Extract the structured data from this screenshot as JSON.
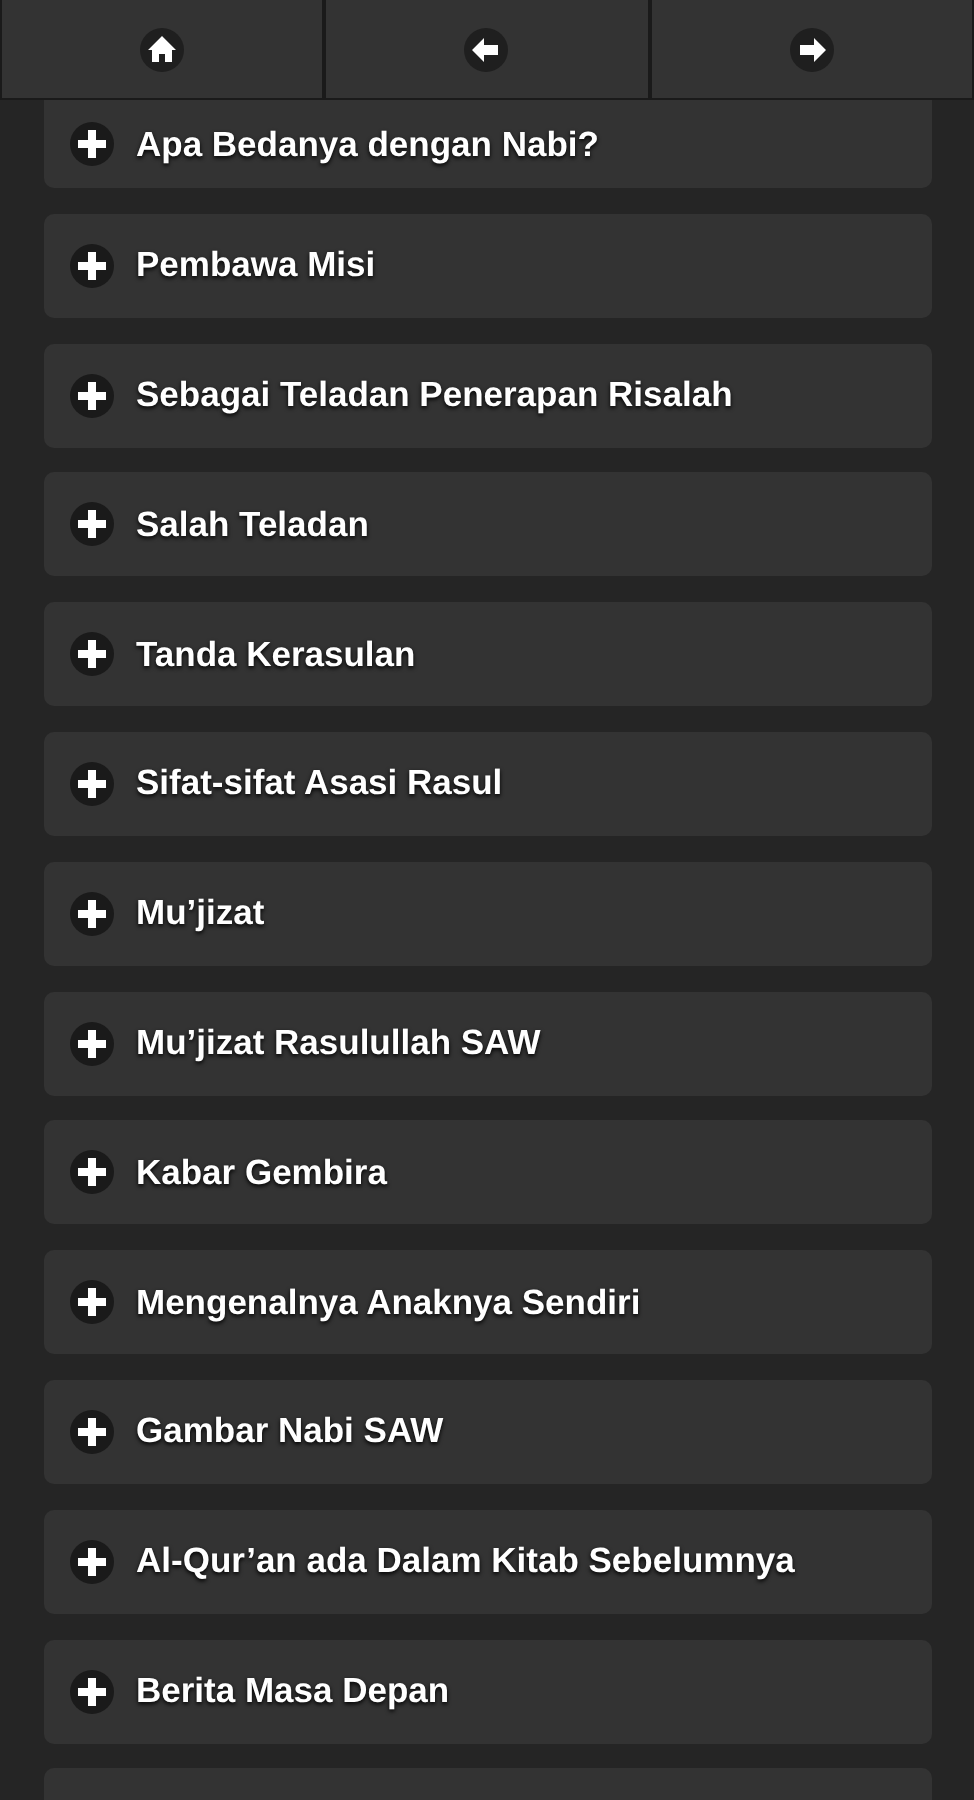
{
  "navbar": {
    "buttons": [
      {
        "kind": "home"
      },
      {
        "kind": "back"
      },
      {
        "kind": "forward"
      }
    ]
  },
  "items": [
    {
      "title": "Apa Bedanya dengan Nabi?",
      "expanded": false
    },
    {
      "title": "Pembawa Misi",
      "expanded": false
    },
    {
      "title": "Sebagai Teladan Penerapan Risalah",
      "expanded": false
    },
    {
      "title": "Salah Teladan",
      "expanded": false
    },
    {
      "title": "Tanda Kerasulan",
      "expanded": false
    },
    {
      "title": "Sifat-sifat Asasi Rasul",
      "expanded": false
    },
    {
      "title": "Mu’jizat",
      "expanded": false
    },
    {
      "title": "Mu’jizat Rasulullah SAW",
      "expanded": false
    },
    {
      "title": "Kabar Gembira",
      "expanded": false
    },
    {
      "title": "Mengenalnya Anaknya Sendiri",
      "expanded": false
    },
    {
      "title": "Gambar Nabi SAW",
      "expanded": false
    },
    {
      "title": "Al-Qur’an ada Dalam Kitab Sebelumnya",
      "expanded": false
    },
    {
      "title": "Berita Masa Depan",
      "expanded": false
    }
  ]
}
